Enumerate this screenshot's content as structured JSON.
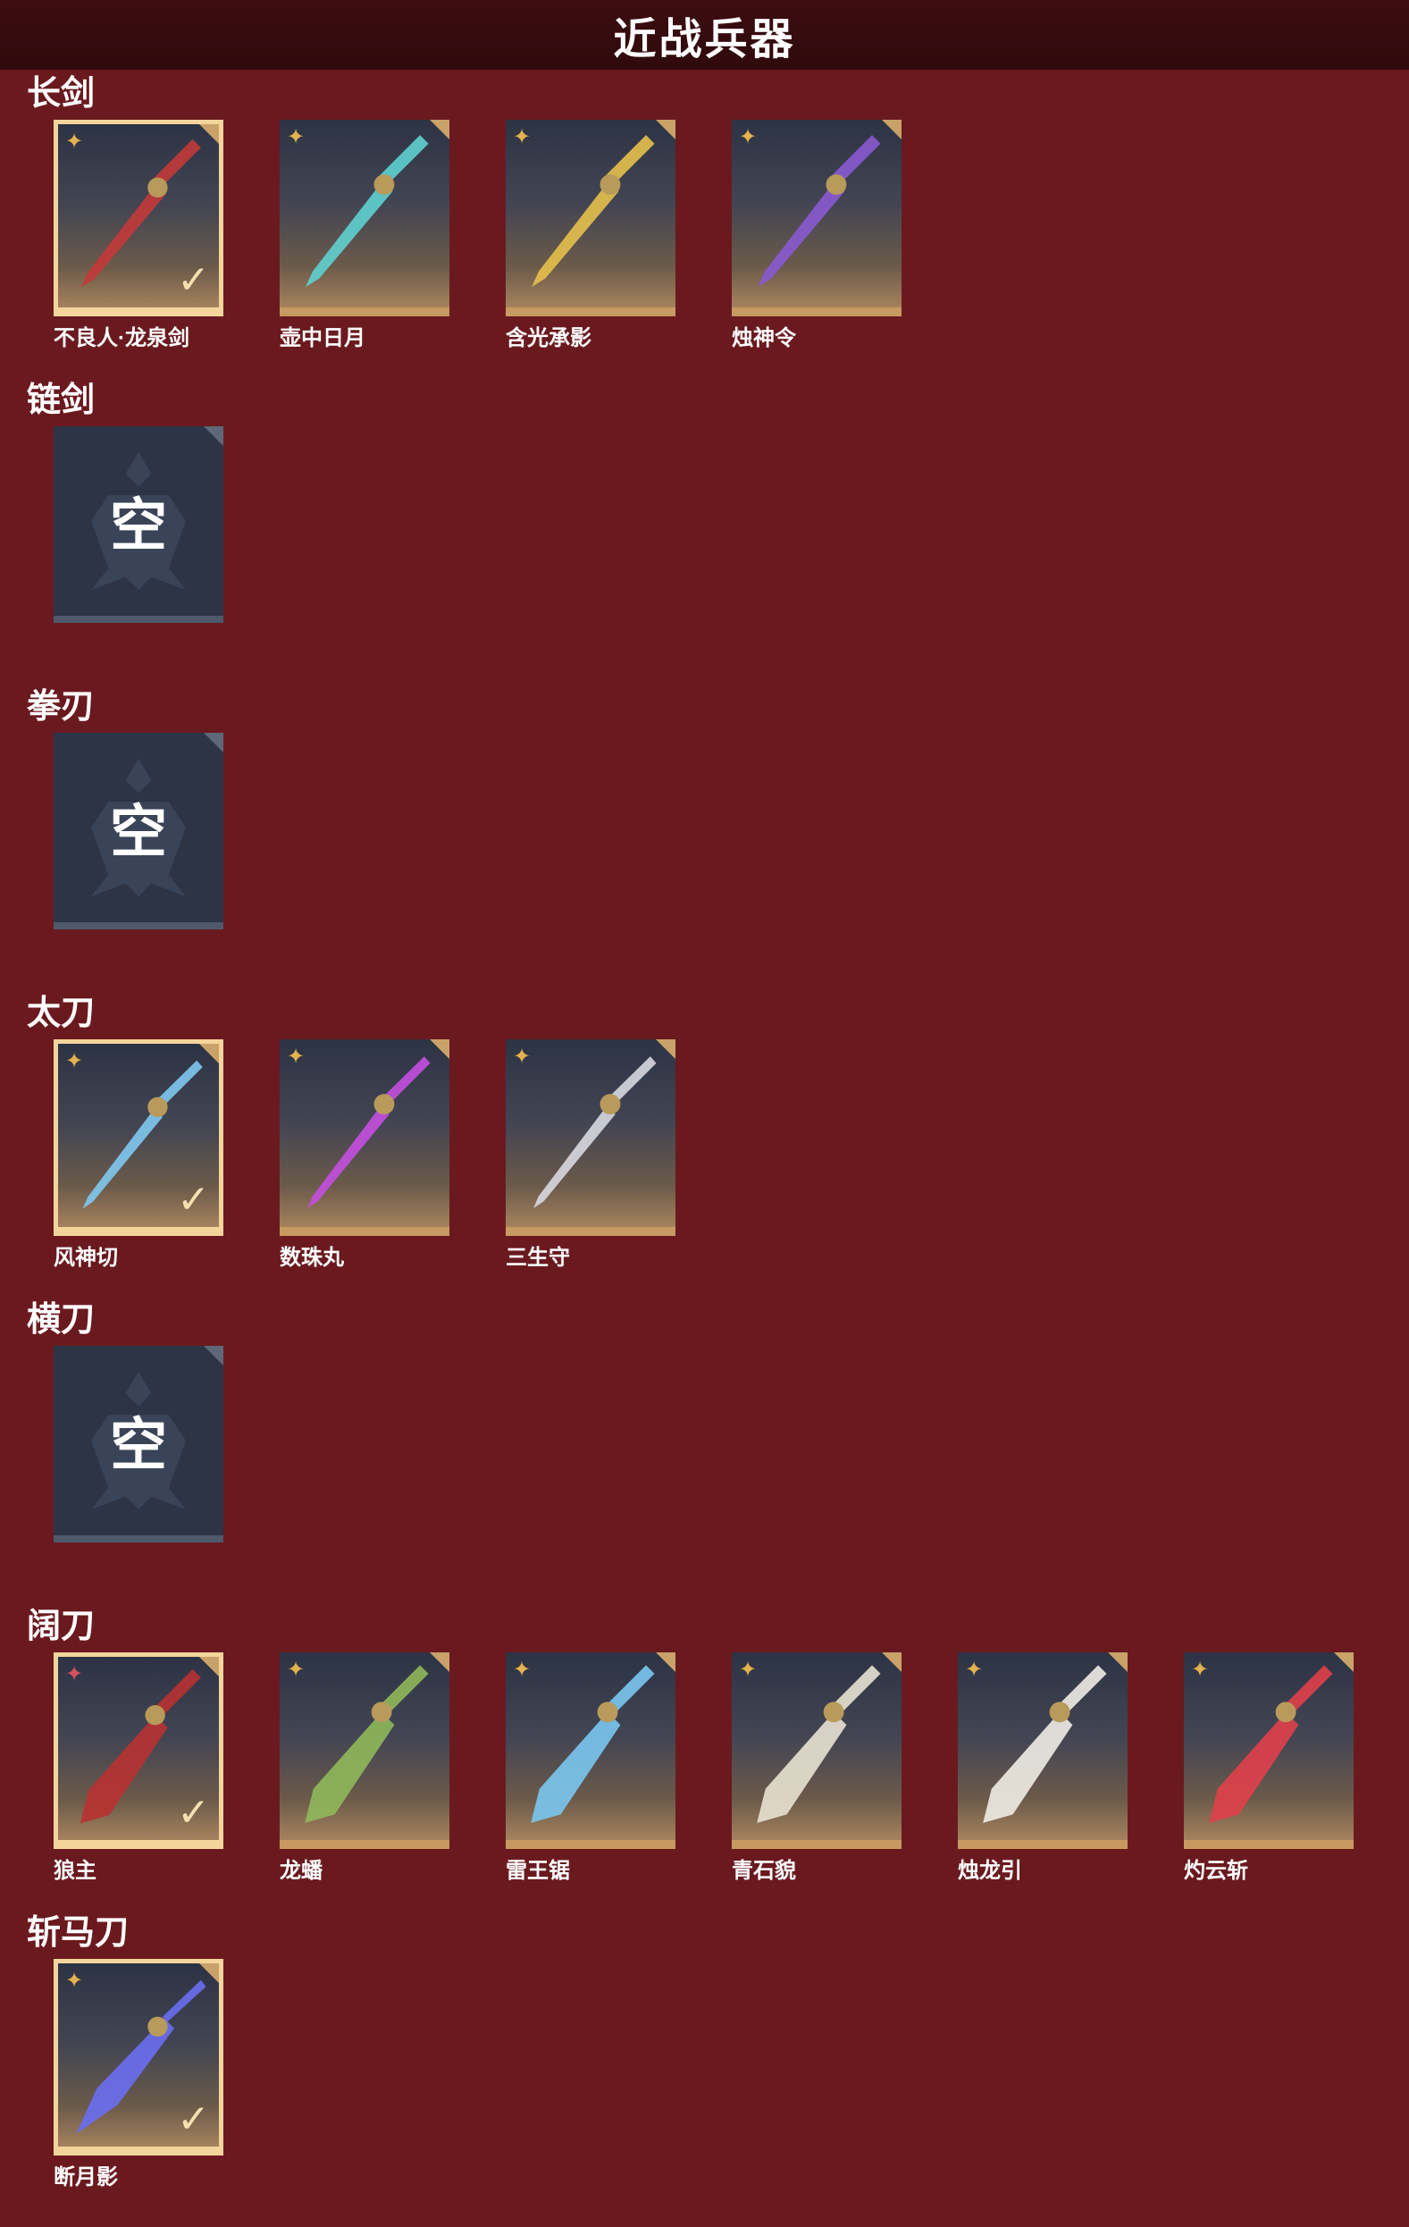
{
  "header": {
    "title": "近战兵器"
  },
  "empty_label": "空",
  "check_glyph": "✓",
  "sections": [
    {
      "title": "长剑",
      "items": [
        {
          "name": "不良人·龙泉剑",
          "equipped": true,
          "rank": "gold",
          "color": "#c23a3a",
          "icon": "sword-icon"
        },
        {
          "name": "壶中日月",
          "equipped": false,
          "rank": "gold",
          "color": "#5fd0d0",
          "icon": "sword-icon"
        },
        {
          "name": "含光承影",
          "equipped": false,
          "rank": "gold",
          "color": "#e6c04d",
          "icon": "sword-icon"
        },
        {
          "name": "烛神令",
          "equipped": false,
          "rank": "gold",
          "color": "#8a5ad0",
          "icon": "sword-icon"
        }
      ]
    },
    {
      "title": "链剑",
      "items": []
    },
    {
      "title": "拳刃",
      "items": []
    },
    {
      "title": "太刀",
      "items": [
        {
          "name": "风神切",
          "equipped": true,
          "rank": "gold",
          "color": "#7fc8ef",
          "icon": "katana-icon"
        },
        {
          "name": "数珠丸",
          "equipped": false,
          "rank": "gold",
          "color": "#c44fe0",
          "icon": "katana-icon"
        },
        {
          "name": "三生守",
          "equipped": false,
          "rank": "gold",
          "color": "#d8d8e0",
          "icon": "katana-icon"
        }
      ]
    },
    {
      "title": "横刀",
      "items": []
    },
    {
      "title": "阔刀",
      "items": [
        {
          "name": "狼主",
          "equipped": true,
          "rank": "red",
          "color": "#b83232",
          "icon": "broadsword-icon"
        },
        {
          "name": "龙蟠",
          "equipped": false,
          "rank": "gold",
          "color": "#8fb85a",
          "icon": "broadsword-icon"
        },
        {
          "name": "雷王锯",
          "equipped": false,
          "rank": "gold",
          "color": "#7ac7ef",
          "icon": "broadsword-icon"
        },
        {
          "name": "青石貌",
          "equipped": false,
          "rank": "gold",
          "color": "#e8e2d2",
          "icon": "broadsword-icon"
        },
        {
          "name": "烛龙引",
          "equipped": false,
          "rank": "gold",
          "color": "#f0ece4",
          "icon": "broadsword-icon"
        },
        {
          "name": "灼云斩",
          "equipped": false,
          "rank": "gold",
          "color": "#e0404a",
          "icon": "broadsword-icon"
        }
      ]
    },
    {
      "title": "斩马刀",
      "items": [
        {
          "name": "断月影",
          "equipped": true,
          "rank": "gold",
          "color": "#6a6ef0",
          "icon": "zanbato-icon"
        }
      ]
    }
  ]
}
